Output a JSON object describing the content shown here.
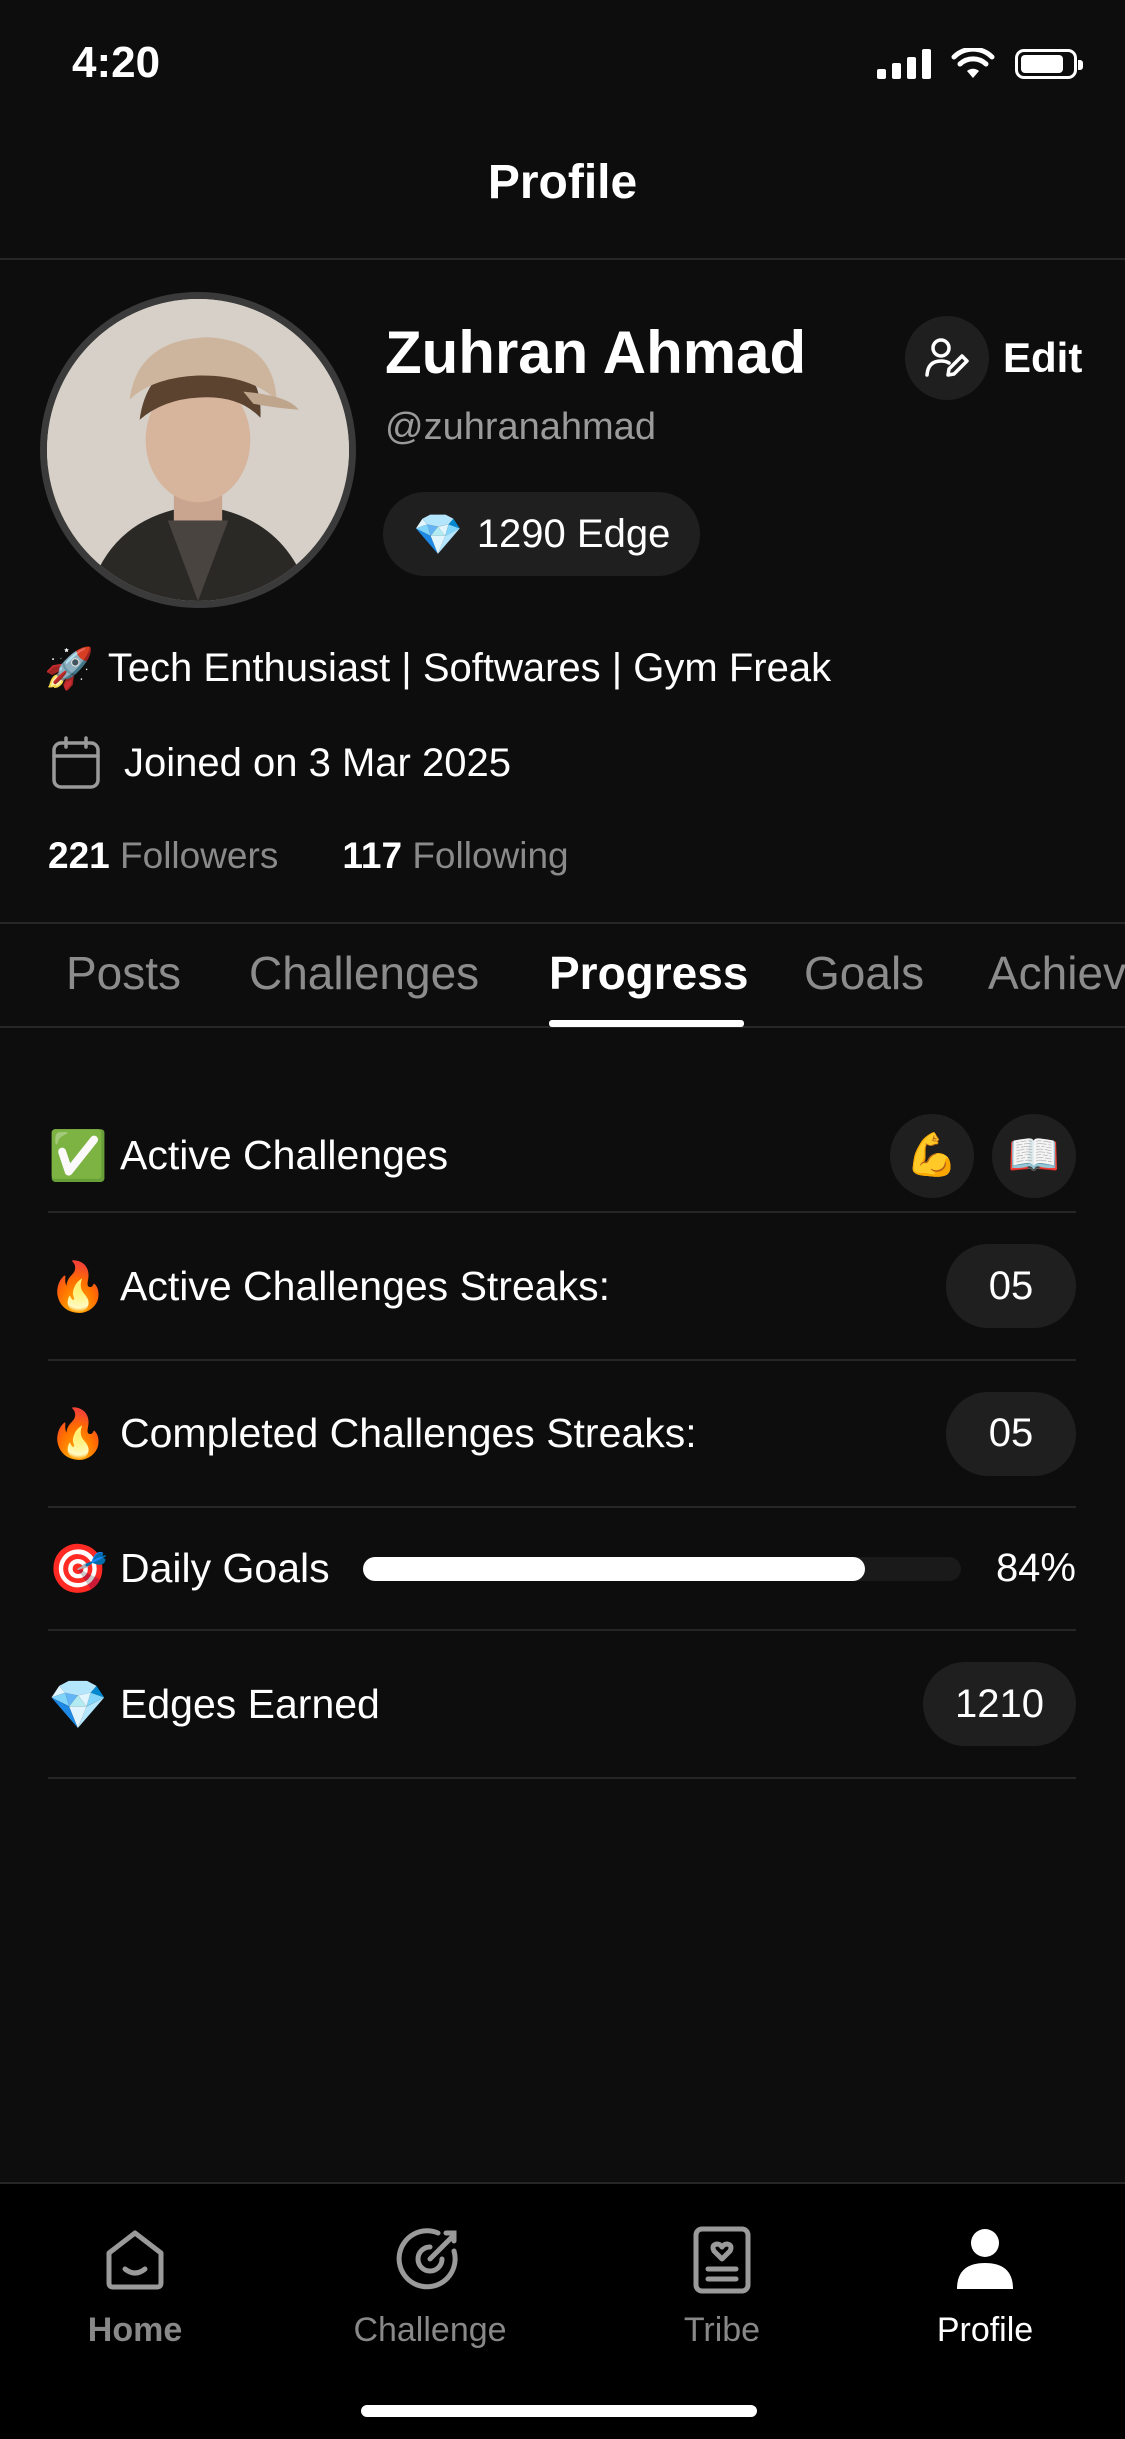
{
  "status_bar": {
    "time": "4:20"
  },
  "header": {
    "title": "Profile"
  },
  "profile": {
    "name": "Zuhran Ahmad",
    "handle": "@zuhranahmad",
    "edge_emoji": "💎",
    "edge_text": "1290 Edge",
    "edit_label": "Edit",
    "bio_emoji": "🚀",
    "bio": "Tech Enthusiast | Softwares | Gym Freak",
    "joined": "Joined on 3 Mar 2025",
    "followers_count": "221",
    "followers_label": "Followers",
    "following_count": "117",
    "following_label": "Following"
  },
  "tabs": [
    {
      "label": "Posts"
    },
    {
      "label": "Challenges"
    },
    {
      "label": "Progress"
    },
    {
      "label": "Goals"
    },
    {
      "label": "Achievements"
    }
  ],
  "active_tab": "Progress",
  "progress": {
    "active_challenges": {
      "emoji": "✅",
      "label": "Active Challenges",
      "badges": [
        "💪",
        "📖"
      ]
    },
    "active_streaks": {
      "emoji": "🔥",
      "label": "Active Challenges Streaks:",
      "value": "05"
    },
    "completed_streaks": {
      "emoji": "🔥",
      "label": "Completed Challenges Streaks:",
      "value": "05"
    },
    "daily_goals": {
      "emoji": "🎯",
      "label": "Daily Goals",
      "percent": 84,
      "percent_text": "84%"
    },
    "edges_earned": {
      "emoji": "💎",
      "label": "Edges Earned",
      "value": "1210"
    }
  },
  "bottom_nav": [
    {
      "label": "Home",
      "icon": "home-icon"
    },
    {
      "label": "Challenge",
      "icon": "target-icon"
    },
    {
      "label": "Tribe",
      "icon": "tribe-icon"
    },
    {
      "label": "Profile",
      "icon": "person-icon"
    }
  ],
  "colors": {
    "background": "#0d0d0d",
    "pill": "#1f1f1f",
    "muted": "#8c8c8c"
  }
}
